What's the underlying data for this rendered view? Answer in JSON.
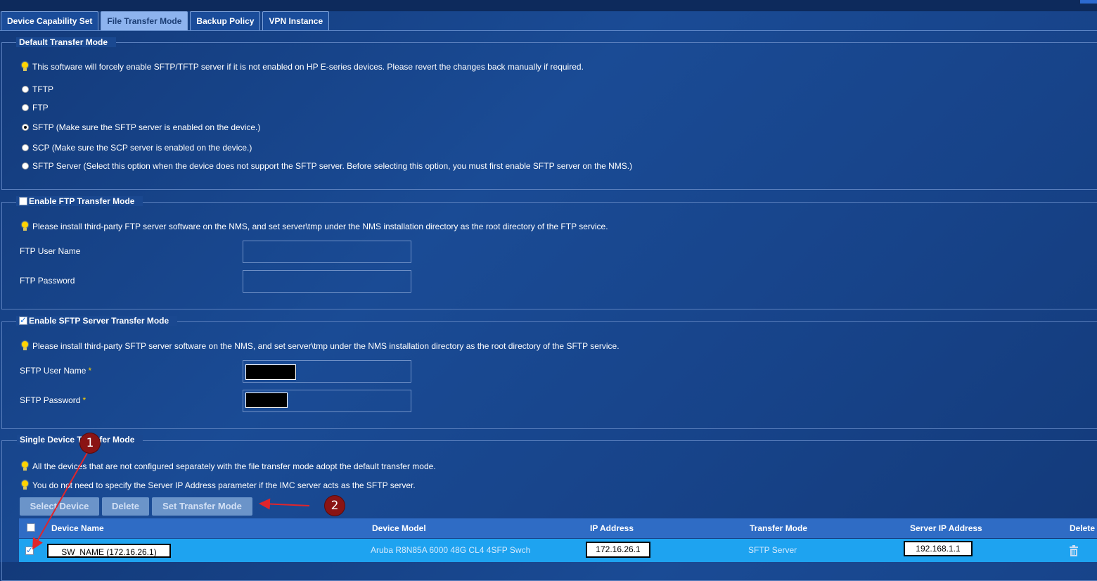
{
  "tabs": [
    {
      "label": "Device Capability Set",
      "active": false
    },
    {
      "label": "File Transfer Mode",
      "active": true
    },
    {
      "label": "Backup Policy",
      "active": false
    },
    {
      "label": "VPN Instance",
      "active": false
    }
  ],
  "default_mode": {
    "title": "Default Transfer Mode",
    "tip": "This software will forcely enable SFTP/TFTP server if it is not enabled on HP E-series devices. Please revert the changes back manually if required.",
    "options": [
      {
        "label": "TFTP",
        "selected": false
      },
      {
        "label": "FTP",
        "selected": false
      },
      {
        "label": "SFTP (Make sure the SFTP server is enabled on the device.)",
        "selected": true
      },
      {
        "label": "SCP (Make sure the SCP server is enabled on the device.)",
        "selected": false
      },
      {
        "label": "SFTP Server (Select this option when the device does not support the SFTP server. Before selecting this option, you must first enable SFTP server on the NMS.)",
        "selected": false
      }
    ]
  },
  "ftp": {
    "title": "Enable FTP Transfer Mode",
    "checked": false,
    "tip": "Please install third-party FTP server software on the NMS, and set server\\tmp under the NMS installation directory as the root directory of the FTP service.",
    "user_label": "FTP User Name",
    "user_value": "",
    "password_label": "FTP Password",
    "password_value": ""
  },
  "sftp": {
    "title": "Enable SFTP Server Transfer Mode",
    "checked": true,
    "tip": "Please install third-party SFTP server software on the NMS, and set server\\tmp under the NMS installation directory as the root directory of the SFTP service.",
    "user_label": "SFTP User Name",
    "password_label": "SFTP Password",
    "required_mark": "*"
  },
  "single": {
    "title": "Single Device Transfer Mode",
    "tip1": "All the devices that are not configured separately with the file transfer mode adopt the default transfer mode.",
    "tip2": "You do not need to specify the Server IP Address parameter if the IMC server acts as the SFTP server.",
    "buttons": {
      "select": "Select Device",
      "delete": "Delete",
      "set_mode": "Set Transfer Mode"
    },
    "columns": {
      "device_name": "Device Name",
      "device_model": "Device Model",
      "ip": "IP Address",
      "mode": "Transfer Mode",
      "server_ip": "Server IP Address",
      "delete": "Delete"
    },
    "rows": [
      {
        "checked": true,
        "device_name": "SW_NAME (172.16.26.1)",
        "device_model": "Aruba R8N85A 6000 48G CL4 4SFP Swch",
        "ip": "172.16.26.1",
        "mode": "SFTP Server",
        "server_ip": "192.168.1.1"
      }
    ]
  },
  "annotations": {
    "marker1": "1",
    "marker2": "2",
    "arrow_color": "#e0252b"
  },
  "colors": {
    "accent_tab": "#8db3ee",
    "table_header": "#2f6cc5",
    "selected_row": "#1ea3f0",
    "tip_bulb": "#ffd400"
  }
}
